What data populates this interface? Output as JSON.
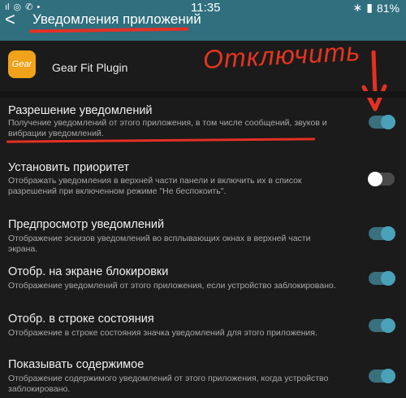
{
  "status": {
    "time": "11:35",
    "battery": "81%"
  },
  "header": {
    "title": "Уведомления приложений",
    "back": "<"
  },
  "app": {
    "logo_text": "Gear",
    "name": "Gear Fit Plugin"
  },
  "annotation": {
    "text": "Отключить"
  },
  "colors": {
    "header": "#2f6f7e",
    "accent": "#4aa2b8",
    "annotation": "#e53024"
  },
  "settings": [
    {
      "title": "Разрешение уведомлений",
      "desc": "Получение уведомлений от этого приложения, в том числе сообщений, звуков и вибрации уведомлений.",
      "on": true
    },
    {
      "title": "Установить приоритет",
      "desc": "Отображать уведомления в верхней части панели и включить их в список разрешений при включенном режиме \"Не беспокоить\".",
      "on": false
    },
    {
      "title": "Предпросмотр уведомлений",
      "desc": "Отображение эскизов уведомлений во всплывающих окнах в верхней части экрана.",
      "on": true
    },
    {
      "title": "Отобр. на экране блокировки",
      "desc": "Отображение уведомлений от этого приложения, если устройство заблокировано.",
      "on": true
    },
    {
      "title": "Отобр. в строке состояния",
      "desc": "Отображение в строке состояния значка уведомлений для этого приложения.",
      "on": true
    },
    {
      "title": "Показывать содержимое",
      "desc": "Отображение содержимого уведомлений от этого приложения, когда устройство заблокировано.",
      "on": true
    }
  ]
}
